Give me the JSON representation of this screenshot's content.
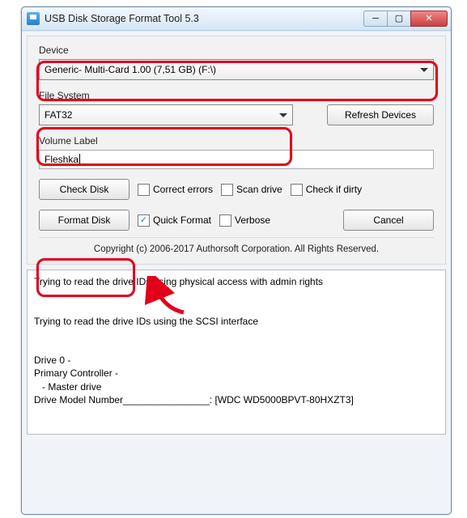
{
  "window": {
    "title": "USB Disk Storage Format Tool 5.3"
  },
  "labels": {
    "device": "Device",
    "filesystem": "File System",
    "volume": "Volume Label"
  },
  "device": {
    "selected": "Generic-  Multi-Card  1.00 (7,51 GB) (F:\\)"
  },
  "filesystem": {
    "selected": "FAT32"
  },
  "volume": {
    "value": "Fleshka"
  },
  "buttons": {
    "refresh": "Refresh Devices",
    "check": "Check Disk",
    "format": "Format Disk",
    "cancel": "Cancel"
  },
  "checks": {
    "correct": "Correct errors",
    "scan": "Scan drive",
    "dirty": "Check if dirty",
    "quick": "Quick Format",
    "verbose": "Verbose"
  },
  "copyright": "Copyright (c) 2006-2017 Authorsoft Corporation. All Rights Reserved.",
  "log": "Trying to read the drive IDs using physical access with admin rights\n\n\nTrying to read the drive IDs using the SCSI interface\n\n\nDrive 0 -\nPrimary Controller -\n   - Master drive\nDrive Model Number________________: [WDC WD5000BPVT-80HXZT3]"
}
